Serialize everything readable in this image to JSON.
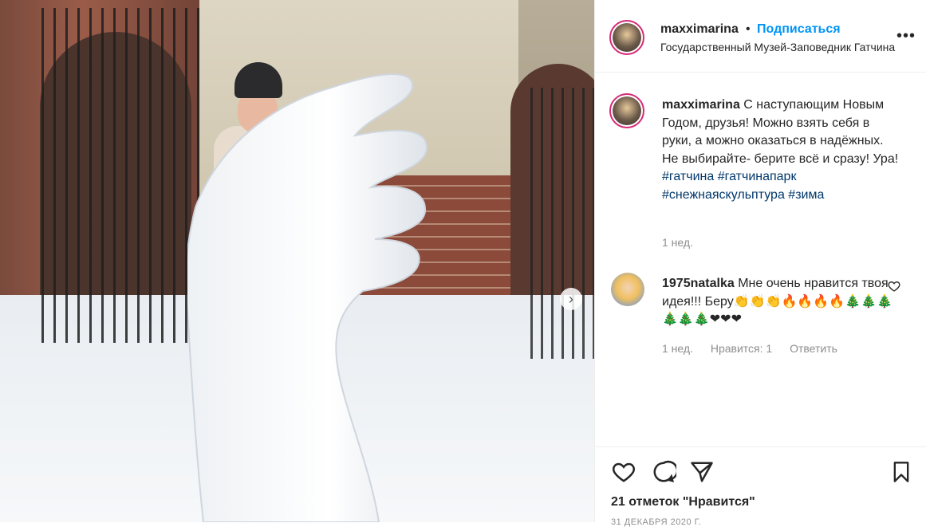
{
  "post": {
    "username": "maxximarina",
    "dot": "•",
    "follow_label": "Подписаться",
    "location": "Государственный Музей-Заповедник Гатчина",
    "more_icon": "more-horizontal-icon"
  },
  "caption": {
    "username": "maxximarina",
    "text": "С наступающим Новым Годом, друзья! Можно взять себя в руки, а можно оказаться в надёжных. Не выбирайте- берите всё и сразу! Ура!",
    "hashtags": [
      "#гатчина",
      "#гатчинапарк",
      "#снежнаяскульптура",
      "#зима"
    ],
    "time": "1 нед."
  },
  "comment": {
    "username": "1975natalka",
    "text": "Мне очень нравится твоя идея!!! Беру👏👏👏🔥🔥🔥🔥🎄🎄🎄🎄🎄🎄❤❤❤",
    "time": "1 нед.",
    "likes_label": "Нравится: 1",
    "reply_label": "Ответить"
  },
  "actions": {
    "likes_text": "21 отметок \"Нравится\"",
    "date_text": "31 ДЕКАБРЯ 2020 Г."
  }
}
